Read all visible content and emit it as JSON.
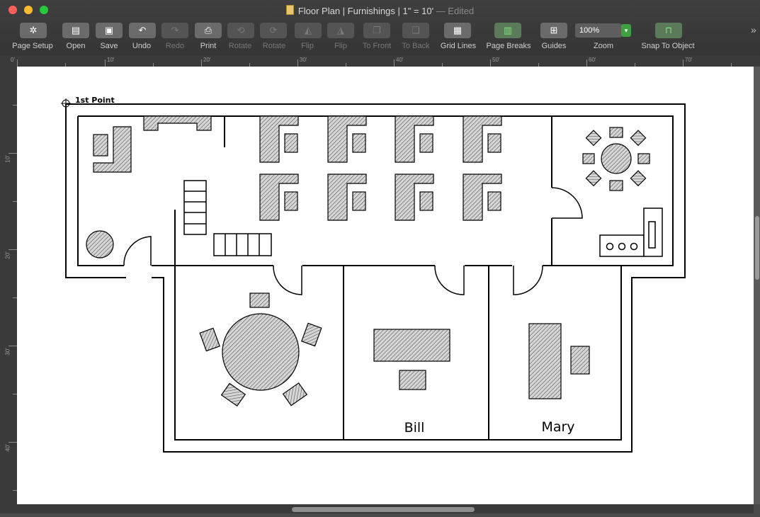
{
  "window": {
    "title": "Floor Plan | Furnishings | 1\" = 10'",
    "edited": "— Edited"
  },
  "toolbar": {
    "items": [
      {
        "label": "Page Setup",
        "icon": "gear-icon",
        "glyph": "✲",
        "enabled": true
      },
      {
        "label": "Open",
        "icon": "folder-icon",
        "glyph": "▤",
        "enabled": true
      },
      {
        "label": "Save",
        "icon": "floppy-icon",
        "glyph": "▣",
        "enabled": true
      },
      {
        "label": "Undo",
        "icon": "undo-icon",
        "glyph": "↶",
        "enabled": true
      },
      {
        "label": "Redo",
        "icon": "redo-icon",
        "glyph": "↷",
        "enabled": false
      },
      {
        "label": "Print",
        "icon": "printer-icon",
        "glyph": "⎙",
        "enabled": true
      },
      {
        "label": "Rotate",
        "icon": "rotate-left-icon",
        "glyph": "⟲",
        "enabled": false
      },
      {
        "label": "Rotate",
        "icon": "rotate-right-icon",
        "glyph": "⟳",
        "enabled": false
      },
      {
        "label": "Flip",
        "icon": "flip-horizontal-icon",
        "glyph": "◭",
        "enabled": false
      },
      {
        "label": "Flip",
        "icon": "flip-vertical-icon",
        "glyph": "◮",
        "enabled": false
      },
      {
        "label": "To Front",
        "icon": "bring-to-front-icon",
        "glyph": "❐",
        "enabled": false
      },
      {
        "label": "To Back",
        "icon": "send-to-back-icon",
        "glyph": "❏",
        "enabled": false
      },
      {
        "label": "Grid Lines",
        "icon": "grid-icon",
        "glyph": "▦",
        "enabled": true
      },
      {
        "label": "Page Breaks",
        "icon": "page-breaks-icon",
        "glyph": "▥",
        "enabled": true,
        "accent": true
      },
      {
        "label": "Guides",
        "icon": "guides-icon",
        "glyph": "⊞",
        "enabled": true
      }
    ],
    "zoom": {
      "label": "Zoom",
      "value": "100%"
    },
    "snap": {
      "label": "Snap To Object",
      "icon": "snap-icon",
      "glyph": "⊓"
    },
    "overflow_glyph": "»"
  },
  "ruler": {
    "horizontal": [
      "0'",
      "10'",
      "20'",
      "30'",
      "40'",
      "50'",
      "60'",
      "70'"
    ],
    "vertical": [
      "10'",
      "20'",
      "30'",
      "40'"
    ]
  },
  "plan": {
    "start_label": "1st Point",
    "rooms": [
      {
        "name": "Bill"
      },
      {
        "name": "Mary"
      }
    ]
  },
  "colors": {
    "chrome": "#3a3a3a",
    "canvas": "#ffffff",
    "accent_green": "#3ea03e",
    "close": "#fc5f57",
    "minimize": "#fdbc2e",
    "zoom_button": "#28c840"
  }
}
